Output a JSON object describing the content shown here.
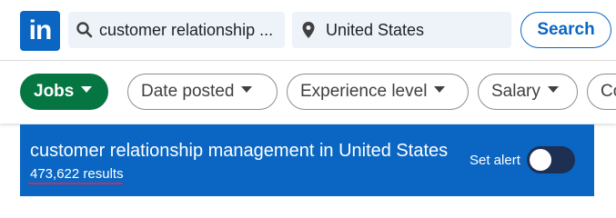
{
  "header": {
    "logo_text": "in",
    "search": {
      "value": "customer relationship ...",
      "icon": "search-icon"
    },
    "location": {
      "value": "United States",
      "icon": "location-pin-icon"
    },
    "search_button": "Search"
  },
  "filters": [
    {
      "label": "Jobs",
      "active": true
    },
    {
      "label": "Date posted"
    },
    {
      "label": "Experience level"
    },
    {
      "label": "Salary"
    },
    {
      "label": "Co"
    }
  ],
  "banner": {
    "title": "customer relationship management in United States",
    "results": "473,622 results",
    "alert_label": "Set alert",
    "alert_enabled": false
  },
  "colors": {
    "brand": "#0a66c2",
    "jobs_active": "#057642",
    "toggle_off": "#1d2f53"
  }
}
